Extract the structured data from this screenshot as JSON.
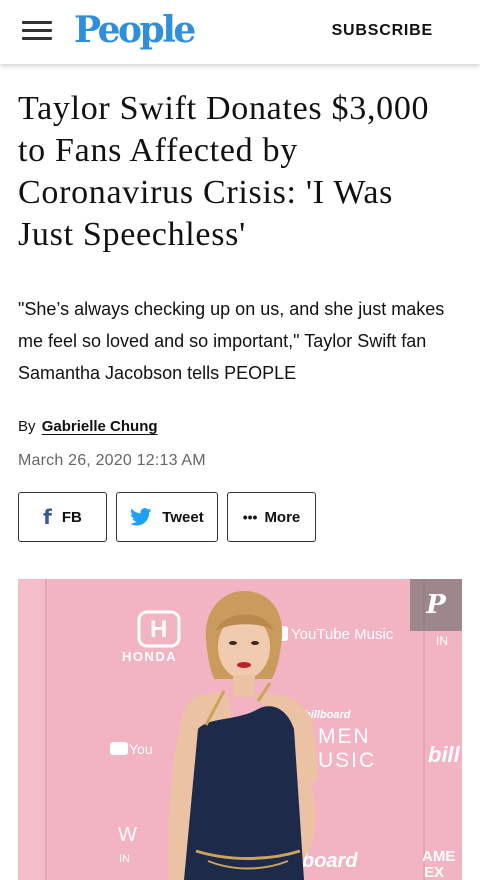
{
  "header": {
    "logo": "People",
    "subscribe_label": "SUBSCRIBE",
    "menu_icon": "hamburger-menu-icon"
  },
  "article": {
    "headline": "Taylor Swift Donates $3,000 to Fans Affected by Coronavirus Crisis: 'I Was Just Speechless'",
    "dek": "\"She’s always checking up on us, and she just makes me feel so loved and so important,\" Taylor Swift fan Samantha Jacobson tells PEOPLE",
    "byline_prefix": "By",
    "author": "Gabrielle Chung",
    "date": "March 26, 2020 12:13 AM"
  },
  "share": {
    "fb_label": "FB",
    "tweet_label": "Tweet",
    "more_label": "More",
    "fb_icon": "facebook-icon",
    "twitter_icon": "twitter-bird-icon",
    "more_icon": "ellipsis-icon"
  },
  "hero": {
    "backdrop_texts": {
      "honda": "HONDA",
      "youtube_music": "YouTube Music",
      "youtube_left": "You",
      "billboard_mid": "billboard",
      "women_in_music": "MEN",
      "music": "USIC",
      "billboard_right": "bill",
      "billboard_bottom": "board",
      "w_left": "W",
      "in_left": "IN",
      "ame": "AME",
      "ex": "EX",
      "in_right": "IN"
    },
    "pin_icon": "pinterest-icon",
    "colors": {
      "backdrop": "#f2b3c2",
      "dress": "#1e2a4a"
    }
  },
  "colors": {
    "brand": "#2f8fdc",
    "facebook": "#3b5998",
    "twitter": "#1da1f2"
  }
}
